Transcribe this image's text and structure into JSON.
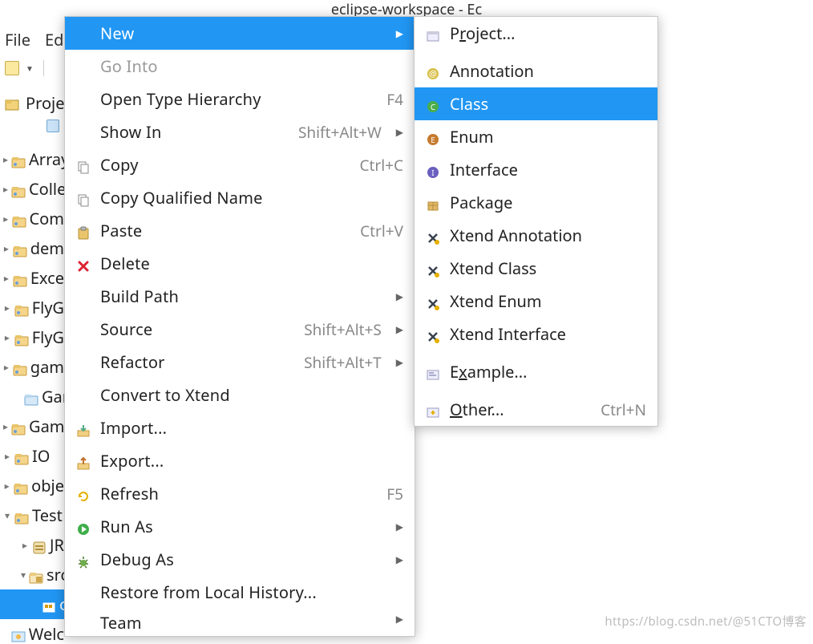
{
  "title": "eclipse-workspace - Ec",
  "menubar": [
    "File",
    "Edi"
  ],
  "module_tab": "Projec",
  "tree": [
    {
      "label": "Array",
      "twist": "▸",
      "icon": "pkg"
    },
    {
      "label": "Colle",
      "twist": "▸",
      "icon": "pkg"
    },
    {
      "label": "Com",
      "twist": "▸",
      "icon": "pkg"
    },
    {
      "label": "dem",
      "twist": "▸",
      "icon": "pkg"
    },
    {
      "label": "Exce",
      "twist": "▸",
      "icon": "pkg"
    },
    {
      "label": "FlyG",
      "twist": "▸",
      "icon": "pkg"
    },
    {
      "label": "FlyG",
      "twist": "▸",
      "icon": "pkg"
    },
    {
      "label": "gam",
      "twist": "▸",
      "icon": "pkg"
    },
    {
      "label": "Gam",
      "twist": "",
      "icon": "folder",
      "indent": 1,
      "noTwist": true
    },
    {
      "label": "Gam",
      "twist": "▸",
      "icon": "pkg"
    },
    {
      "label": "IO",
      "twist": "▸",
      "icon": "pkg"
    },
    {
      "label": "obje",
      "twist": "▸",
      "icon": "pkg"
    },
    {
      "label": "Test",
      "twist": "▾",
      "icon": "pkg",
      "open": true
    },
    {
      "label": "JR",
      "twist": "▸",
      "icon": "jar",
      "indent": 1
    },
    {
      "label": "src",
      "twist": "▾",
      "icon": "src",
      "indent": 1,
      "open": true
    },
    {
      "label": "c",
      "twist": "",
      "icon": "pkgsel",
      "indent": 2,
      "sel": true,
      "noTwist": true,
      "iconsel": true
    },
    {
      "label": "Welc",
      "twist": "",
      "icon": "welcome",
      "indent": 0,
      "noTwist": true
    }
  ],
  "context": [
    {
      "label": "New",
      "head": true,
      "arrow": true
    },
    {
      "label": "Go Into",
      "disabled": true
    },
    {
      "label": "Open Type Hierarchy",
      "short": "F4"
    },
    {
      "label": "Show In",
      "short": "Shift+Alt+W",
      "arrow": true
    },
    {
      "label": "Copy",
      "short": "Ctrl+C",
      "icon": "copy"
    },
    {
      "label": "Copy Qualified Name",
      "icon": "copy"
    },
    {
      "label": "Paste",
      "short": "Ctrl+V",
      "icon": "paste"
    },
    {
      "label": "Delete",
      "icon": "delete"
    },
    {
      "label": "Build Path",
      "arrow": true
    },
    {
      "label": "Source",
      "short": "Shift+Alt+S",
      "arrow": true
    },
    {
      "label": "Refactor",
      "short": "Shift+Alt+T",
      "arrow": true
    },
    {
      "label": "Convert to Xtend"
    },
    {
      "label": "Import...",
      "icon": "import"
    },
    {
      "label": "Export...",
      "icon": "export"
    },
    {
      "label": "Refresh",
      "short": "F5",
      "icon": "refresh"
    },
    {
      "label": "Run As",
      "arrow": true,
      "icon": "run"
    },
    {
      "label": "Debug As",
      "arrow": true,
      "icon": "debug"
    },
    {
      "label": "Restore from Local History..."
    },
    {
      "label": "Team",
      "arrow": true,
      "cut": true
    }
  ],
  "submenu": [
    {
      "pre": "P",
      "mn": "r",
      "post": "oject...",
      "icon": "proj"
    },
    {
      "pre": "",
      "mn": "",
      "post": "Annotation",
      "icon": "anno",
      "sepBefore": true
    },
    {
      "pre": "",
      "mn": "",
      "post": "Class",
      "icon": "class",
      "sel": true
    },
    {
      "pre": "",
      "mn": "",
      "post": "Enum",
      "icon": "enum"
    },
    {
      "pre": "",
      "mn": "",
      "post": "Interface",
      "icon": "iface"
    },
    {
      "pre": "",
      "mn": "",
      "post": "Package",
      "icon": "package"
    },
    {
      "pre": "",
      "mn": "",
      "post": "Xtend Annotation",
      "icon": "xanno"
    },
    {
      "pre": "",
      "mn": "",
      "post": "Xtend Class",
      "icon": "xclass"
    },
    {
      "pre": "",
      "mn": "",
      "post": "Xtend Enum",
      "icon": "xenum"
    },
    {
      "pre": "",
      "mn": "",
      "post": "Xtend Interface",
      "icon": "xiface"
    },
    {
      "pre": "E",
      "mn": "x",
      "post": "ample...",
      "icon": "example",
      "sepBefore": true
    },
    {
      "pre": "",
      "mn": "O",
      "post": "ther...",
      "icon": "other",
      "short": "Ctrl+N",
      "sepBefore": true
    }
  ],
  "watermark": "https://blog.csdn.net/@51CTO博客"
}
